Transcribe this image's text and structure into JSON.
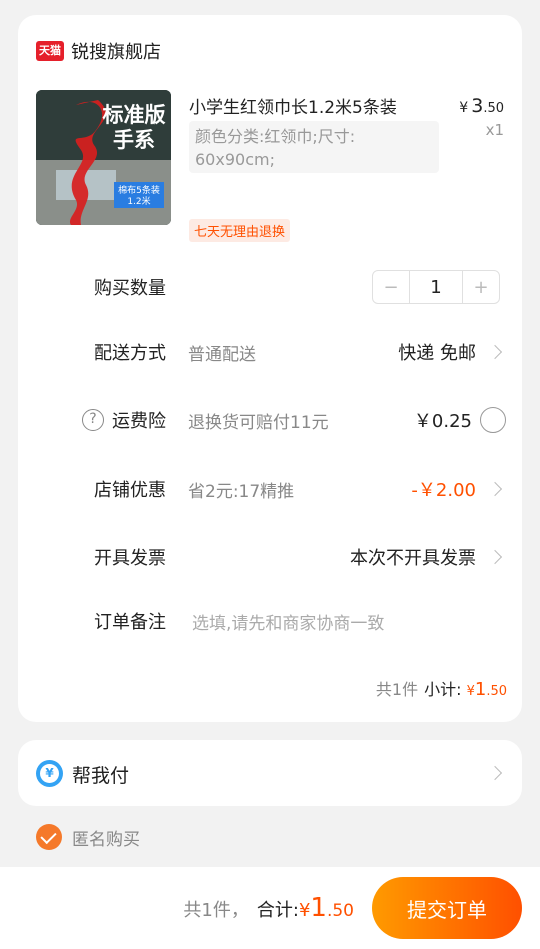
{
  "shop": {
    "badge": "天猫",
    "name": "锐搜旗舰店"
  },
  "product": {
    "title": "小学生红领巾长1.2米5条装",
    "sku_line1": "颜色分类:红领巾;尺寸:",
    "sku_line2": "60x90cm;",
    "price_currency": "¥",
    "price_int": "3",
    "price_dec": ".50",
    "quantity_label": "x1",
    "return_tag": "七天无理由退换",
    "image_text": {
      "main1": "标准版",
      "main2": "手系",
      "sub1": "棉布5条装",
      "sub2": "1.2米"
    }
  },
  "quantity": {
    "label": "购买数量",
    "minus": "−",
    "value": "1",
    "plus": "+"
  },
  "delivery": {
    "label": "配送方式",
    "sub": "普通配送",
    "value": "快递 免邮"
  },
  "insurance": {
    "help": "?",
    "label": "运费险",
    "sub": "退换货可赔付11元",
    "value": "￥0.25"
  },
  "coupon": {
    "label": "店铺优惠",
    "sub": "省2元:17精推",
    "value": "-￥2.00"
  },
  "invoice": {
    "label": "开具发票",
    "value": "本次不开具发票"
  },
  "note": {
    "label": "订单备注",
    "placeholder": "选填,请先和商家协商一致"
  },
  "subtotal": {
    "count": "共1件",
    "label": "小计:",
    "currency": "¥",
    "int": "1",
    "dec": ".50"
  },
  "pay_for_me": {
    "icon": "¥",
    "label": "帮我付"
  },
  "anonymous": {
    "label": "匿名购买",
    "checked": true
  },
  "footer": {
    "count": "共1件，",
    "label": "合计:",
    "currency": "¥",
    "int": "1",
    "dec": ".50",
    "submit": "提交订单"
  },
  "colors": {
    "accent": "#ff5000",
    "gradient_start": "#ff9a00",
    "tmall_red": "#e5202b",
    "pay_blue": "#33a3f4"
  }
}
